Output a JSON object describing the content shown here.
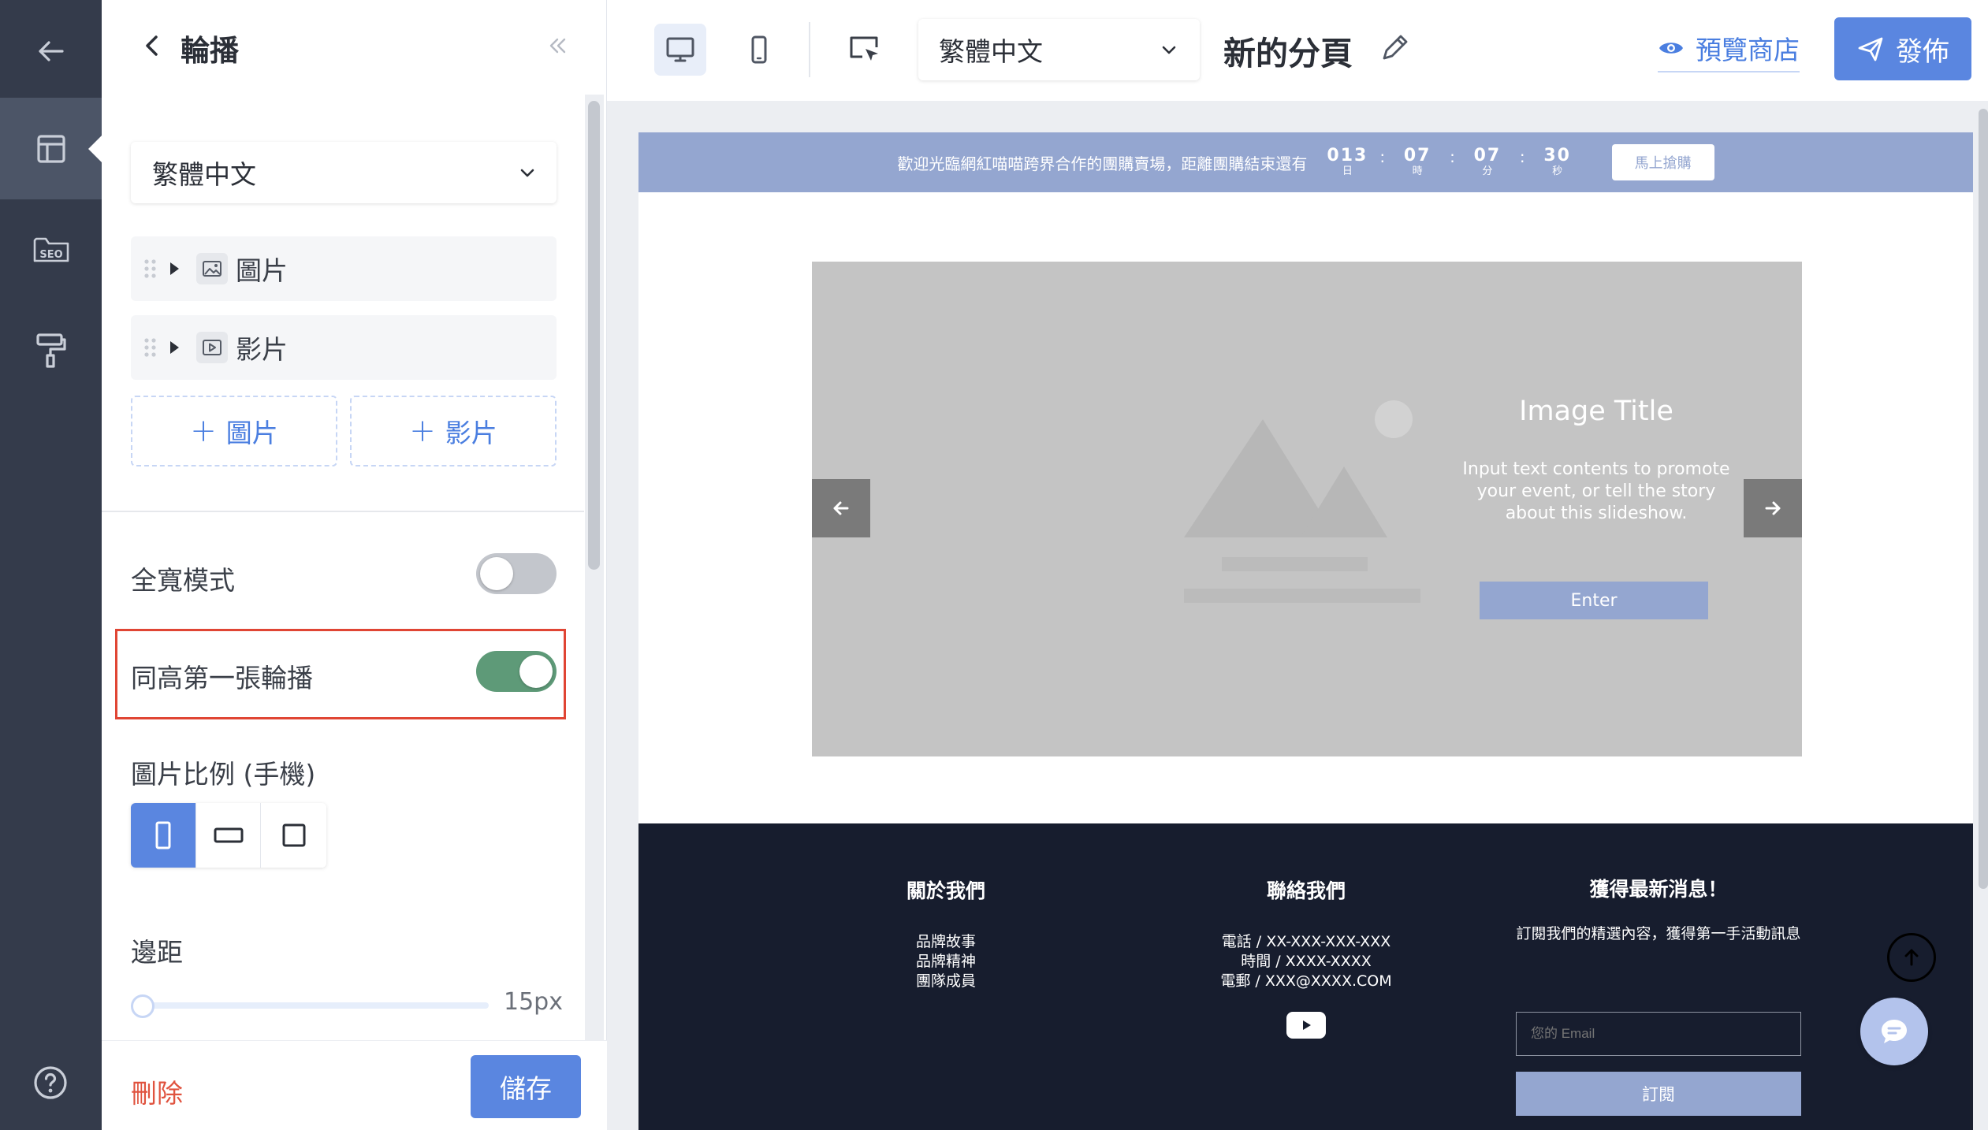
{
  "rail": {
    "icons": [
      "back-arrow-icon",
      "layout-icon",
      "seo-folder-icon",
      "paint-roller-icon",
      "help-icon"
    ],
    "seo_text": "SEO"
  },
  "panel": {
    "title": "輪播",
    "language": "繁體中文",
    "items": [
      {
        "label": "圖片",
        "icon": "image-icon"
      },
      {
        "label": "影片",
        "icon": "video-icon"
      }
    ],
    "add_image": "圖片",
    "add_video": "影片",
    "full_width_label": "全寬模式",
    "full_width_on": false,
    "same_height_label": "同高第一張輪播",
    "same_height_on": true,
    "ratio_label": "圖片比例 (手機)",
    "ratio_selected": "portrait",
    "margin_label": "邊距",
    "margin_value": "15px",
    "delete_label": "刪除",
    "save_label": "儲存"
  },
  "topbar": {
    "language": "繁體中文",
    "page_name": "新的分頁",
    "preview_label": "預覽商店",
    "publish_label": "發佈",
    "active_device": "desktop"
  },
  "site": {
    "announcement": "歡迎光臨網紅喵喵跨界合作的團購賣場，距離團購結束還有",
    "countdown": [
      {
        "value": "013",
        "label": "日"
      },
      {
        "value": "07",
        "label": "時"
      },
      {
        "value": "07",
        "label": "分"
      },
      {
        "value": "30",
        "label": "秒"
      }
    ],
    "buy_label": "馬上搶購",
    "slide": {
      "title": "Image Title",
      "text": "Input text contents to promote your event, or tell the story about this slideshow.",
      "button": "Enter"
    },
    "footer": {
      "about_title": "關於我們",
      "about_links": [
        "品牌故事",
        "品牌精神",
        "團隊成員"
      ],
      "contact_title": "聯絡我們",
      "contact_lines": [
        "電話 / XX-XXX-XXX-XXX",
        "時間 / XXXX-XXXX",
        "電郵 / XXX@XXXX.COM"
      ],
      "news_title": "獲得最新消息！",
      "news_text": "訂閱我們的精選內容，獲得第一手活動訊息",
      "email_placeholder": "您的 Email",
      "subscribe_label": "訂閱"
    }
  },
  "colors": {
    "accent": "#5a86e0",
    "rail": "#343b4b",
    "toggle_on": "#5e9a78",
    "highlight": "#e04534",
    "announce": "#94a6d0",
    "footer": "#171d2e"
  }
}
